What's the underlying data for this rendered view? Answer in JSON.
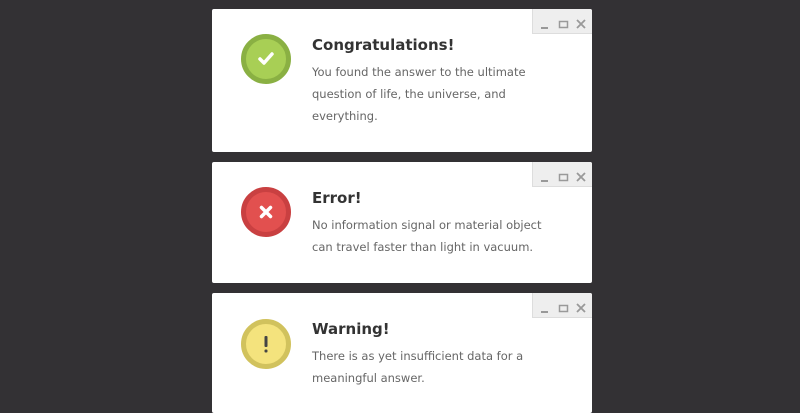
{
  "colors": {
    "background": "#333134",
    "success": "#a8cf55",
    "error": "#e2504f",
    "warning": "#f4e37d"
  },
  "window_controls": {
    "minimize_icon": "minimize-icon",
    "maximize_icon": "maximize-icon",
    "close_icon": "close-icon"
  },
  "dialogs": [
    {
      "type": "success",
      "icon": "checkmark-icon",
      "title": "Congratulations!",
      "message": "You found the answer to the ultimate question of life, the universe, and everything."
    },
    {
      "type": "error",
      "icon": "x-icon",
      "title": "Error!",
      "message": "No information signal or material object can travel faster than light in vacuum."
    },
    {
      "type": "warning",
      "icon": "exclamation-icon",
      "title": "Warning!",
      "message": "There is as yet insufficient data for a meaningful answer."
    }
  ]
}
